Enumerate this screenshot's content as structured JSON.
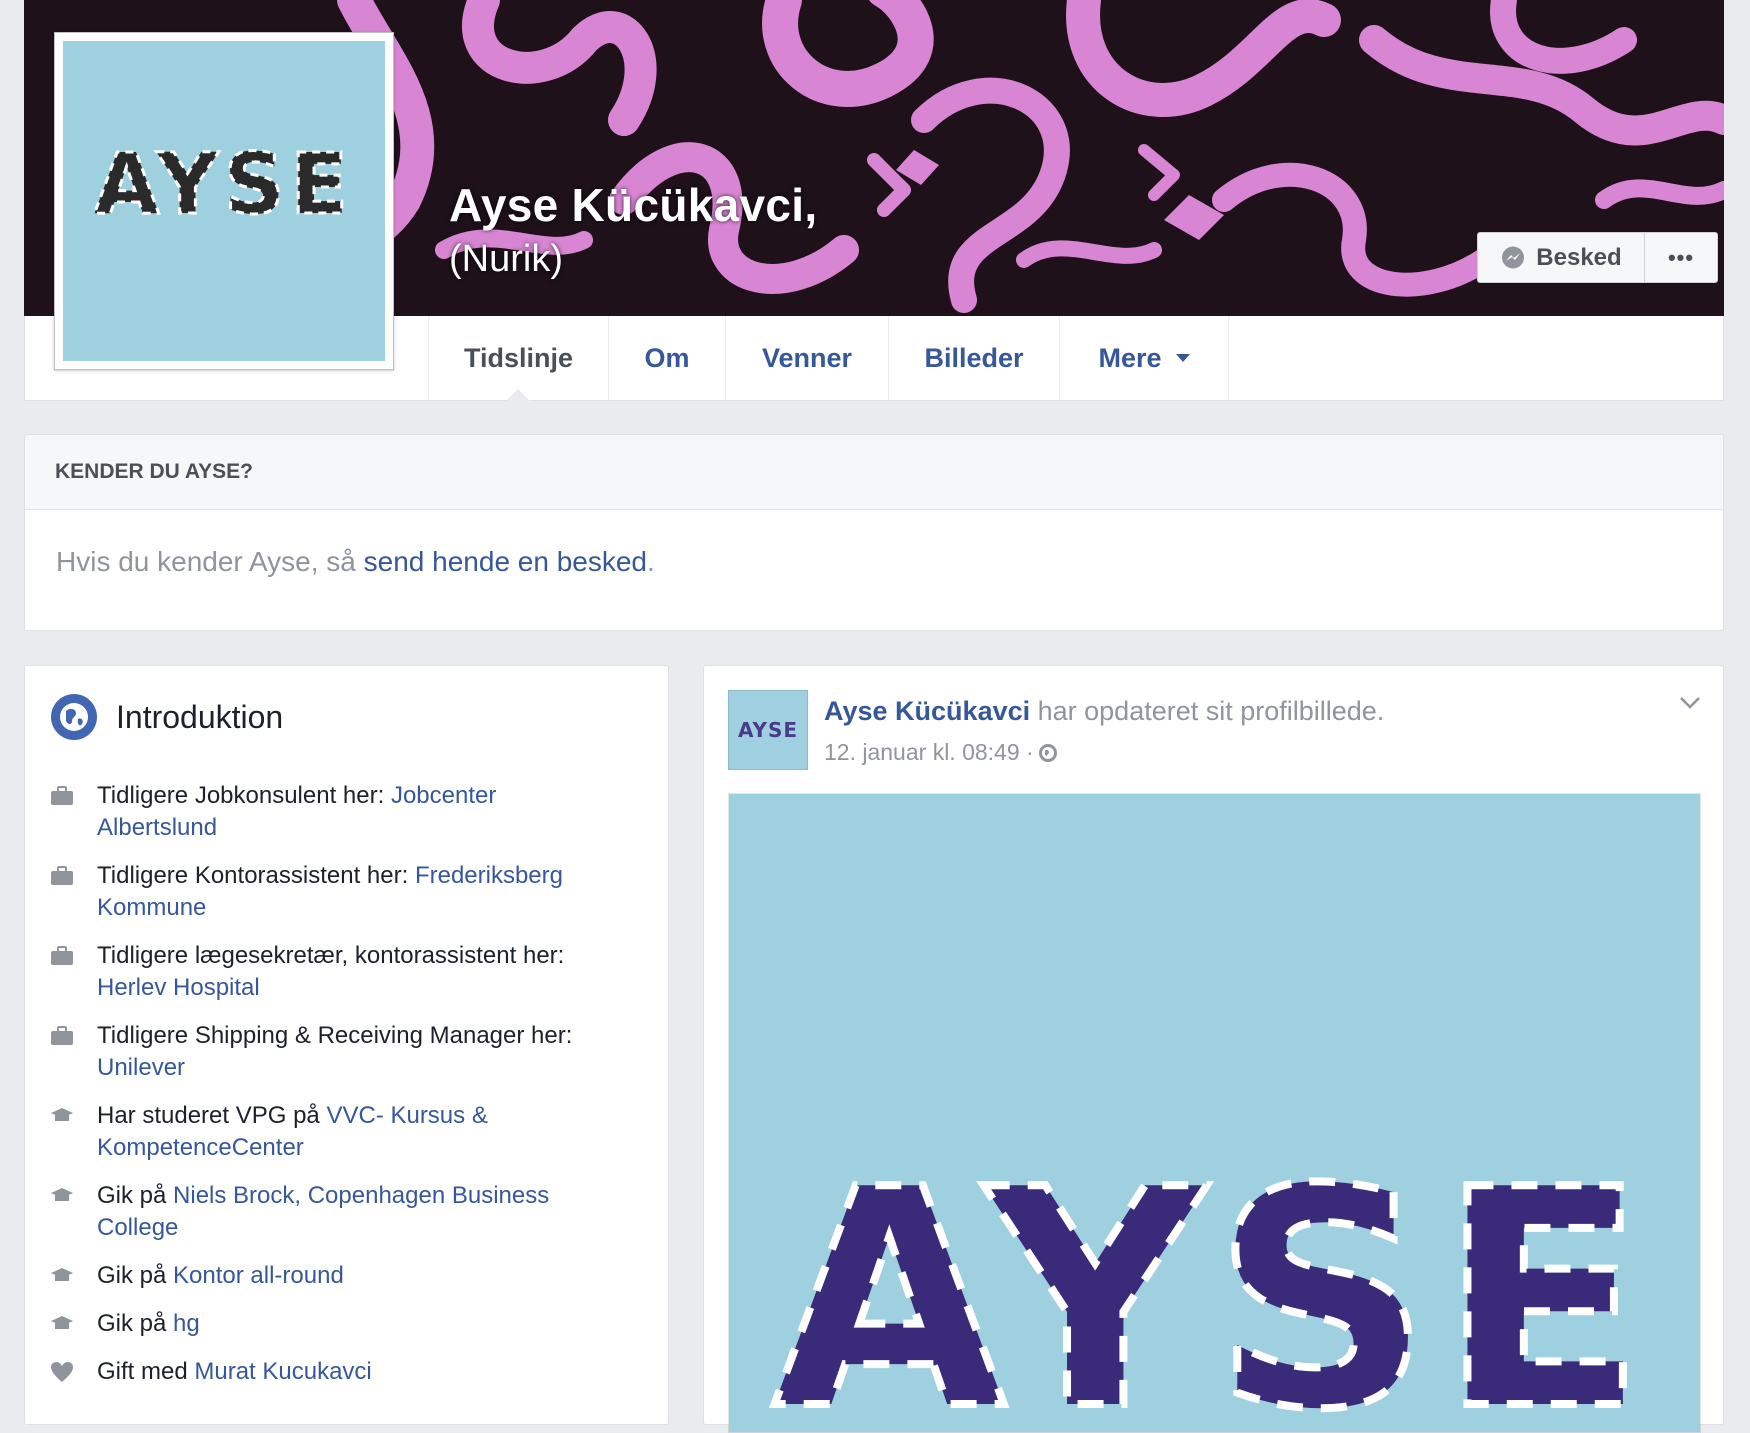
{
  "profile": {
    "name": "Ayse Kücükavci,",
    "alternate_name": "(Nurik)",
    "picture_text": "AYSE"
  },
  "cover_actions": {
    "message_label": "Besked",
    "more_label": "•••"
  },
  "nav": {
    "tabs": [
      {
        "label": "Tidslinje",
        "active": true
      },
      {
        "label": "Om"
      },
      {
        "label": "Venner"
      },
      {
        "label": "Billeder"
      },
      {
        "label": "Mere"
      }
    ]
  },
  "know_box": {
    "header": "KENDER DU AYSE?",
    "prefix": "Hvis du kender Ayse, så ",
    "link": "send hende en besked",
    "suffix": "."
  },
  "intro": {
    "title": "Introduktion",
    "items": [
      {
        "icon": "briefcase-icon",
        "text": "Tidligere Jobkonsulent her: ",
        "link": "Jobcenter Albertslund"
      },
      {
        "icon": "briefcase-icon",
        "text": "Tidligere Kontorassistent her: ",
        "link": "Frederiksberg Kommune"
      },
      {
        "icon": "briefcase-icon",
        "text": "Tidligere lægesekretær, kontorassistent her: ",
        "link": "Herlev Hospital"
      },
      {
        "icon": "briefcase-icon",
        "text": "Tidligere Shipping & Receiving Manager her: ",
        "link": "Unilever"
      },
      {
        "icon": "education-icon",
        "text": "Har studeret VPG på ",
        "link": "VVC- Kursus & KompetenceCenter"
      },
      {
        "icon": "education-icon",
        "text": "Gik på ",
        "link": "Niels Brock, Copenhagen Business College"
      },
      {
        "icon": "education-icon",
        "text": "Gik på ",
        "link": "Kontor all-round"
      },
      {
        "icon": "education-icon",
        "text": "Gik på ",
        "link": "hg"
      },
      {
        "icon": "heart-icon",
        "text": "Gift med ",
        "link": "Murat Kucukavci"
      }
    ]
  },
  "post": {
    "author": "Ayse Kücükavci",
    "action": " har opdateret sit profilbillede.",
    "timestamp": "12. januar kl. 08:49 · ",
    "image_text": "AYSE",
    "avatar_text": "AYSE"
  },
  "colors": {
    "link": "#365899",
    "background": "#e9ebee",
    "cover_pink": "#d47ad0",
    "picture_blue": "#9fd0e0"
  }
}
